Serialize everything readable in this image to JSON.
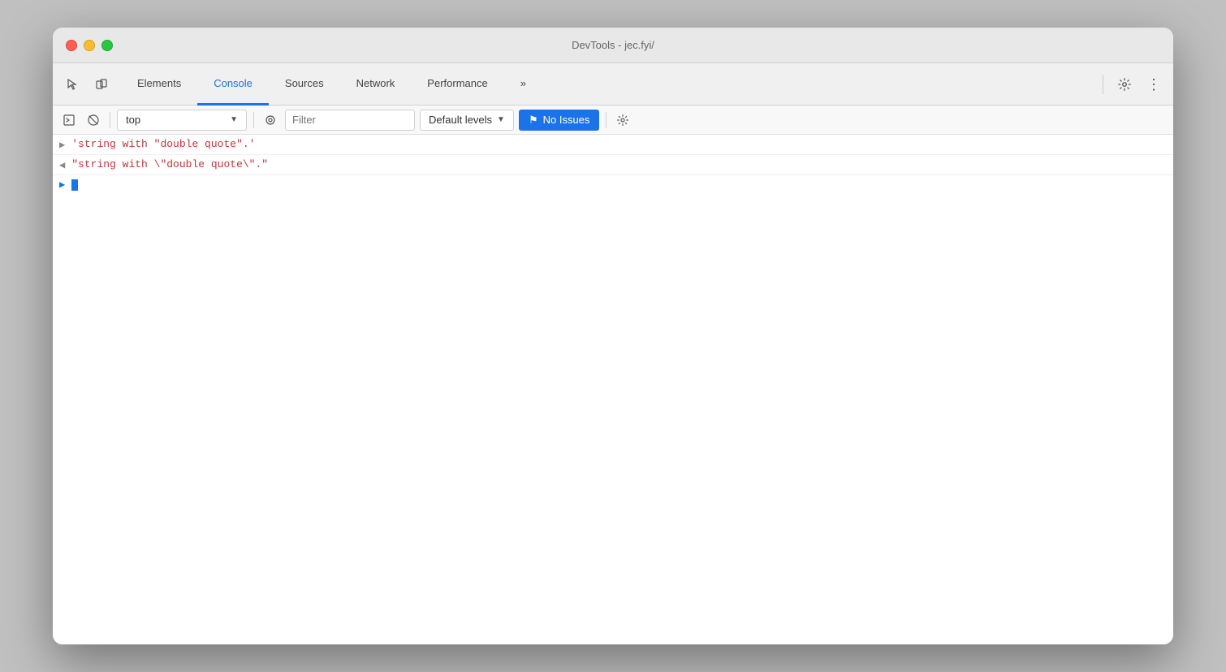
{
  "window": {
    "title": "DevTools - jec.fyi/"
  },
  "tabs": [
    {
      "id": "elements",
      "label": "Elements",
      "active": false
    },
    {
      "id": "console",
      "label": "Console",
      "active": true
    },
    {
      "id": "sources",
      "label": "Sources",
      "active": false
    },
    {
      "id": "network",
      "label": "Network",
      "active": false
    },
    {
      "id": "performance",
      "label": "Performance",
      "active": false
    }
  ],
  "console_toolbar": {
    "context_value": "top",
    "context_arrow": "▼",
    "filter_placeholder": "Filter",
    "levels_label": "Default levels",
    "levels_arrow": "▼",
    "no_issues_label": "No Issues"
  },
  "console_lines": [
    {
      "arrow": ">",
      "arrow_color": "gray",
      "text": "'string with \"double quote\".'",
      "text_color": "red"
    },
    {
      "arrow": "←",
      "arrow_color": "gray",
      "text": "\"string with \\\"double quote\\\".",
      "text_color": "red"
    }
  ],
  "icons": {
    "cursor": "⬆",
    "layers": "⧉",
    "chevrons_more": "»",
    "gear": "⚙",
    "dots": "⋮",
    "play": "▶",
    "ban": "⊘",
    "eye": "👁",
    "message_flag": "⚑"
  },
  "colors": {
    "active_tab": "#1a73e8",
    "console_red": "#c53434",
    "no_issues_bg": "#1a73e8",
    "no_issues_flag": "#4a90d9"
  }
}
